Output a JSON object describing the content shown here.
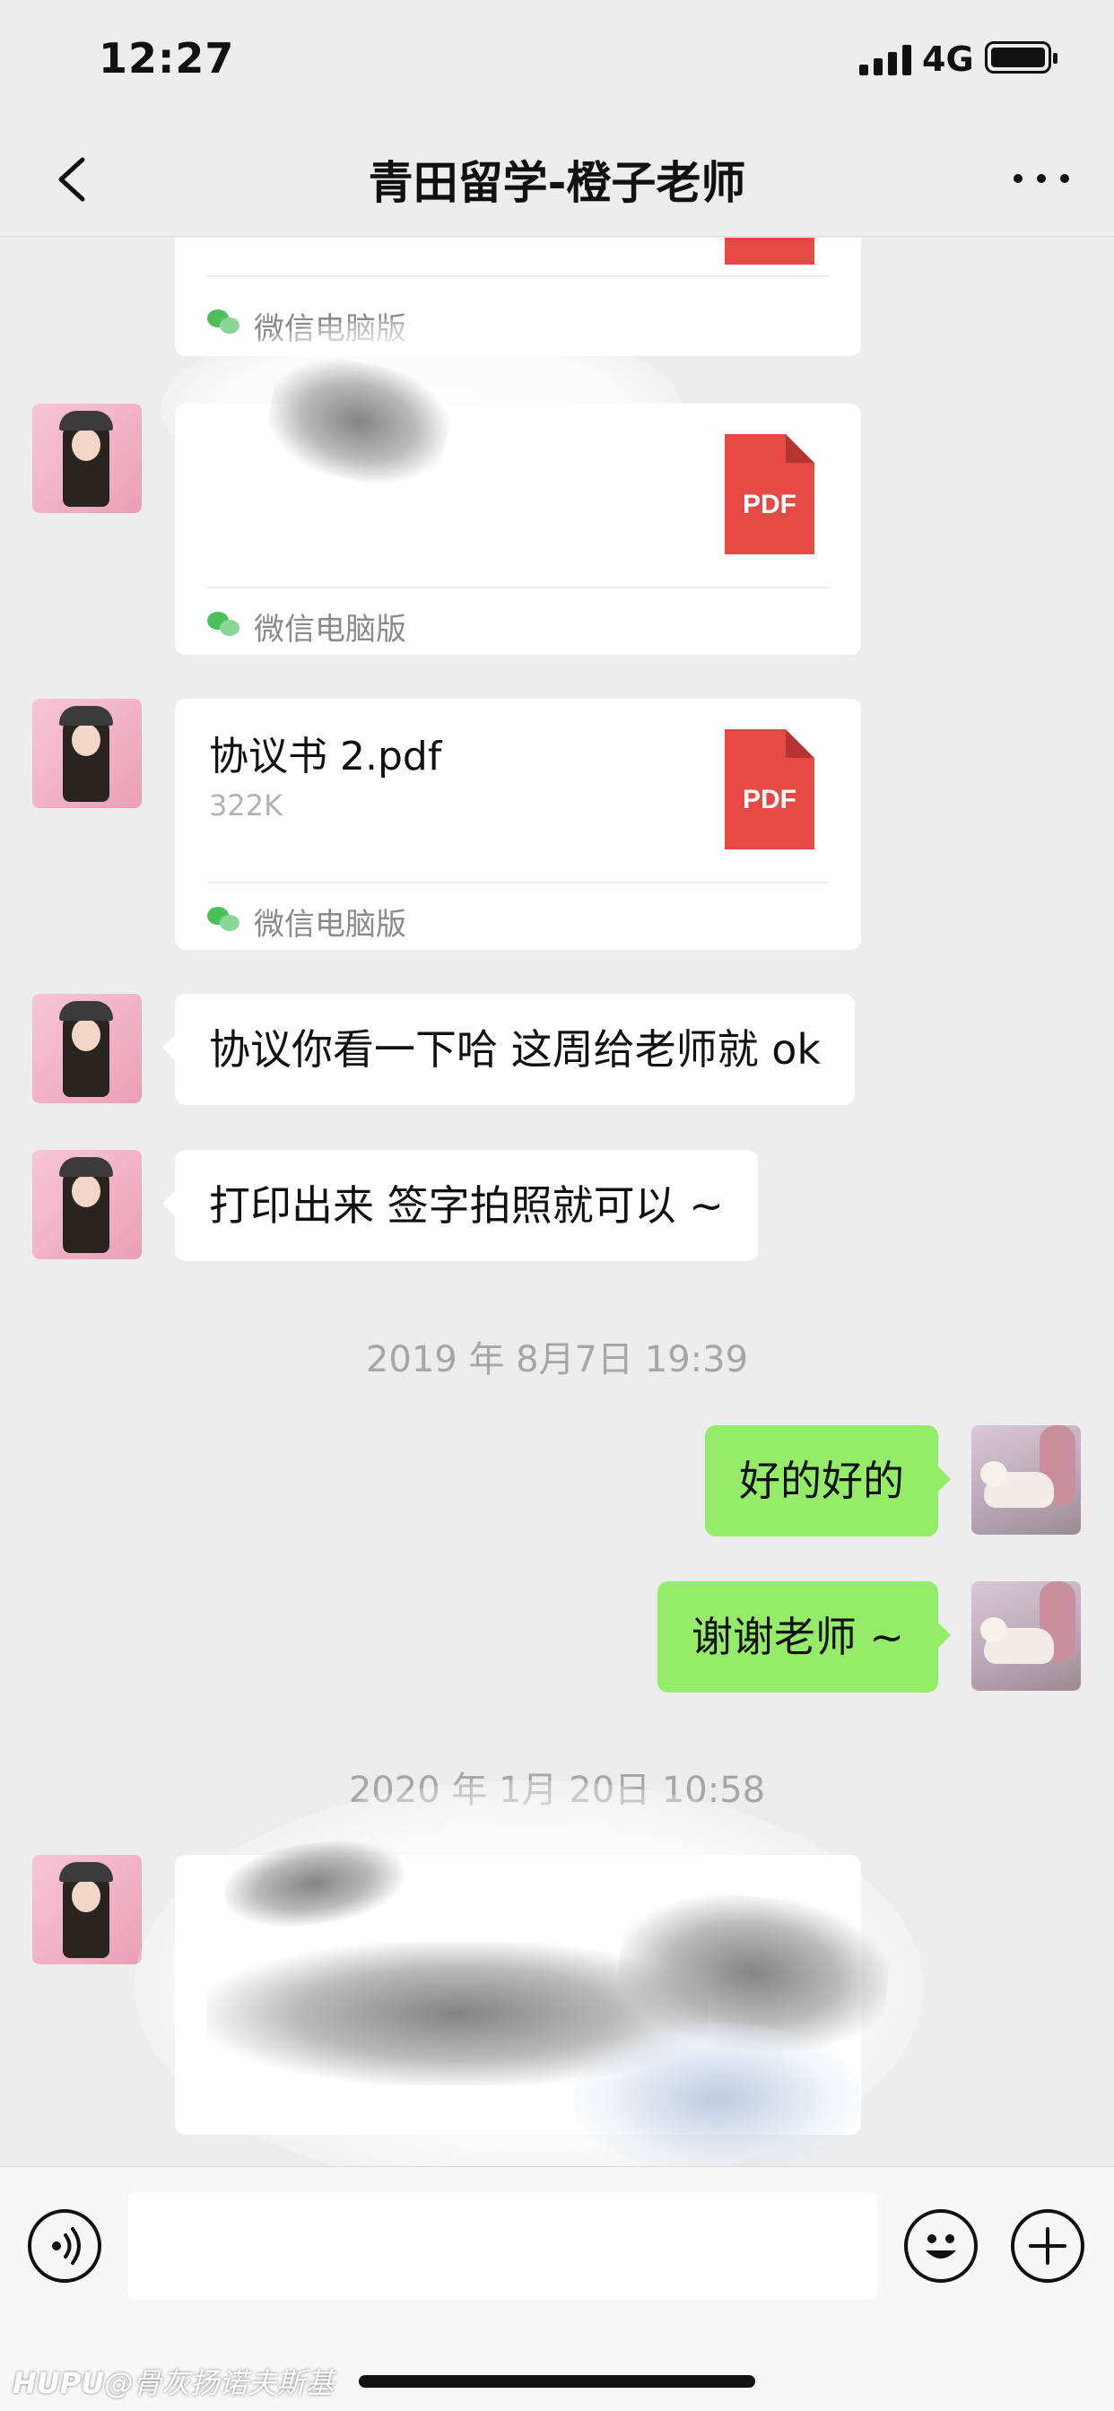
{
  "status_bar": {
    "time": "12:27",
    "network": "4G"
  },
  "nav": {
    "title": "青田留学-橙子老师",
    "back_icon": "chevron-left-icon",
    "more_icon": "ellipsis-icon"
  },
  "messages": {
    "card1": {
      "source": "微信电脑版"
    },
    "card2": {
      "pdf_label": "PDF",
      "source": "微信电脑版"
    },
    "card3": {
      "file_name": "协议书 2.pdf",
      "file_size": "322K",
      "pdf_label": "PDF",
      "source": "微信电脑版"
    },
    "text1": "协议你看一下哈 这周给老师就 ok",
    "text2": "打印出来 签字拍照就可以 ~",
    "time1": "2019 年 8月7日 19:39",
    "out1": "好的好的",
    "out2": "谢谢老师 ~",
    "time2": "2020 年 1月 20日 10:58"
  },
  "colors": {
    "outgoing_bubble": "#95ec69",
    "incoming_bubble": "#ffffff",
    "pdf_red": "#e74a45",
    "background": "#ededed"
  },
  "input_bar": {
    "voice_icon": "voice-icon",
    "emoji_icon": "emoji-icon",
    "add_icon": "plus-icon",
    "text_value": ""
  },
  "watermark": {
    "brand": "HUPU",
    "text": "@骨灰扬诺夫斯基"
  }
}
